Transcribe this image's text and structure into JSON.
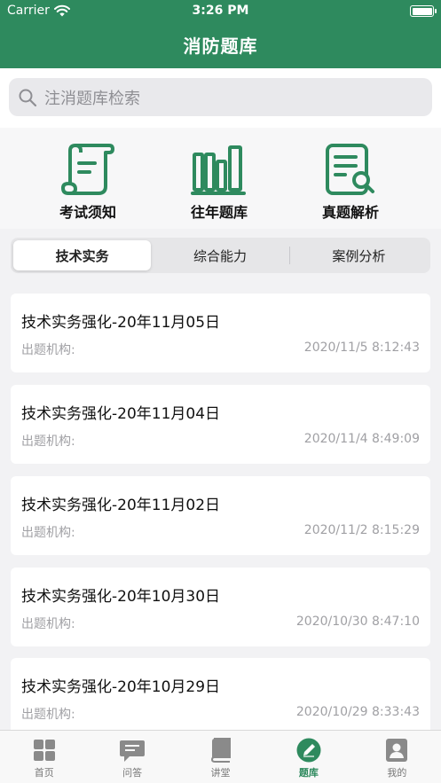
{
  "status_bar": {
    "carrier": "Carrier",
    "time": "3:26 PM"
  },
  "nav": {
    "title": "消防题库"
  },
  "search": {
    "placeholder": "注消题库检索"
  },
  "quick_links": [
    {
      "label": "考试须知",
      "icon": "scroll-icon"
    },
    {
      "label": "往年题库",
      "icon": "books-icon"
    },
    {
      "label": "真题解析",
      "icon": "document-search-icon"
    }
  ],
  "segments": [
    {
      "label": "技术实务",
      "selected": true
    },
    {
      "label": "综合能力",
      "selected": false
    },
    {
      "label": "案例分析",
      "selected": false
    }
  ],
  "exams": [
    {
      "title": "技术实务强化-20年11月05日",
      "org_label": "出题机构:",
      "time": "2020/11/5 8:12:43"
    },
    {
      "title": "技术实务强化-20年11月04日",
      "org_label": "出题机构:",
      "time": "2020/11/4 8:49:09"
    },
    {
      "title": "技术实务强化-20年11月02日",
      "org_label": "出题机构:",
      "time": "2020/11/2 8:15:29"
    },
    {
      "title": "技术实务强化-20年10月30日",
      "org_label": "出题机构:",
      "time": "2020/10/30 8:47:10"
    },
    {
      "title": "技术实务强化-20年10月29日",
      "org_label": "出题机构:",
      "time": "2020/10/29 8:33:43"
    }
  ],
  "tabbar": [
    {
      "label": "首页",
      "icon": "grid-icon",
      "active": false
    },
    {
      "label": "问答",
      "icon": "chat-icon",
      "active": false
    },
    {
      "label": "讲堂",
      "icon": "book-icon",
      "active": false
    },
    {
      "label": "题库",
      "icon": "pencil-icon",
      "active": true
    },
    {
      "label": "我的",
      "icon": "profile-icon",
      "active": false
    }
  ],
  "colors": {
    "brand": "#2e8a5e",
    "muted": "#a0a0a4",
    "tab_inactive": "#777777"
  }
}
